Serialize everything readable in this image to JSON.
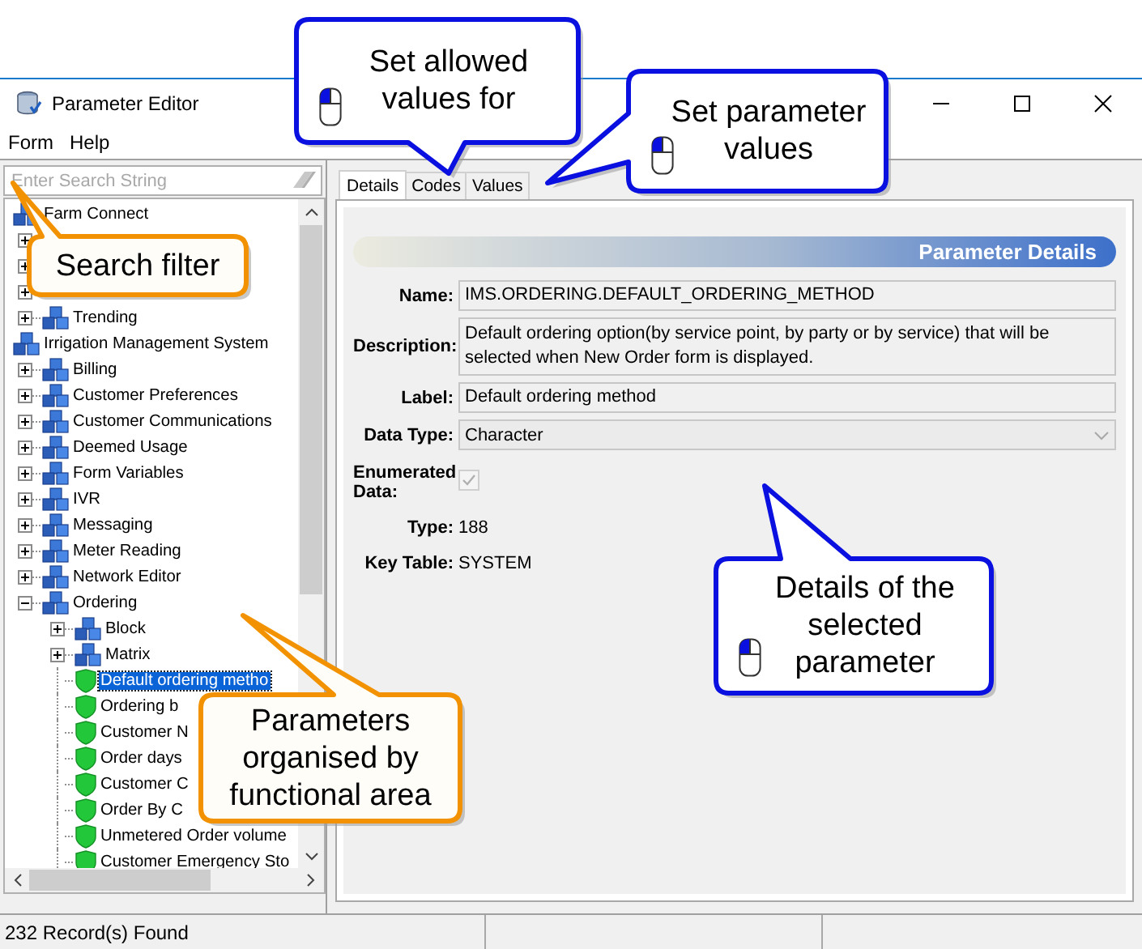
{
  "window": {
    "title": "Parameter Editor"
  },
  "menu": [
    "Form",
    "Help"
  ],
  "search": {
    "placeholder": "Enter Search String"
  },
  "tree": [
    {
      "kind": "group",
      "label": "Farm Connect",
      "children": [
        {
          "kind": "group",
          "expanded": false
        },
        {
          "kind": "group",
          "expanded": false
        },
        {
          "kind": "group",
          "expanded": false
        },
        {
          "kind": "group",
          "label": "Trending",
          "expanded": false
        }
      ]
    },
    {
      "kind": "group",
      "label": "Irrigation Management System",
      "children": [
        {
          "kind": "group",
          "label": "Billing",
          "expanded": false
        },
        {
          "kind": "group",
          "label": "Customer Preferences",
          "expanded": false
        },
        {
          "kind": "group",
          "label": "Customer Communications",
          "expanded": false
        },
        {
          "kind": "group",
          "label": "Deemed Usage",
          "expanded": false
        },
        {
          "kind": "group",
          "label": "Form Variables",
          "expanded": false
        },
        {
          "kind": "group",
          "label": "IVR",
          "expanded": false
        },
        {
          "kind": "group",
          "label": "Messaging",
          "expanded": false
        },
        {
          "kind": "group",
          "label": "Meter Reading",
          "expanded": false
        },
        {
          "kind": "group",
          "label": "Network Editor",
          "expanded": false
        },
        {
          "kind": "group",
          "label": "Ordering",
          "expanded": true,
          "children": [
            {
              "kind": "group",
              "label": "Block",
              "expanded": false
            },
            {
              "kind": "group",
              "label": "Matrix",
              "expanded": false
            },
            {
              "kind": "parameter",
              "label": "Default ordering metho",
              "selected": true
            },
            {
              "kind": "parameter",
              "label": "Ordering b",
              "selected": false
            },
            {
              "kind": "parameter",
              "label": "Customer N",
              "selected": false
            },
            {
              "kind": "parameter",
              "label": "Order days",
              "selected": false
            },
            {
              "kind": "parameter",
              "label": "Customer C",
              "selected": false
            },
            {
              "kind": "parameter",
              "label": "Order By C",
              "selected": false
            },
            {
              "kind": "parameter",
              "label": "Unmetered Order volume",
              "selected": false
            },
            {
              "kind": "parameter",
              "label": "Customer Emergency Sto",
              "selected": false
            }
          ]
        }
      ]
    }
  ],
  "tabs": [
    {
      "label": "Details",
      "selected": true
    },
    {
      "label": "Codes",
      "selected": false
    },
    {
      "label": "Values",
      "selected": false
    }
  ],
  "details": {
    "header": "Parameter Details",
    "fields": [
      {
        "kind": "text",
        "label": "Name:",
        "value": "IMS.ORDERING.DEFAULT_ORDERING_METHOD"
      },
      {
        "kind": "textarea",
        "label": "Description:",
        "value": "Default ordering option(by service point, by party or by service) that will be selected when New Order form is displayed."
      },
      {
        "kind": "text",
        "label": "Label:",
        "value": "Default ordering method"
      },
      {
        "kind": "combo",
        "label": "Data Type:",
        "value": "Character"
      },
      {
        "kind": "checkbox",
        "label": "Enumerated Data:",
        "checked": true
      },
      {
        "kind": "plain",
        "label": "Type:",
        "value": "188"
      },
      {
        "kind": "plain",
        "label": "Key Table:",
        "value": "SYSTEM"
      }
    ]
  },
  "status_bar": {
    "text": "232 Record(s) Found"
  },
  "callouts": [
    {
      "kind": "blue",
      "lines": [
        "Set allowed",
        "values for"
      ],
      "mouse": true
    },
    {
      "kind": "blue",
      "lines": [
        "Set parameter",
        "values"
      ],
      "mouse": true
    },
    {
      "kind": "orange",
      "lines": [
        "Search filter"
      ],
      "mouse": false
    },
    {
      "kind": "orange",
      "lines": [
        "Parameters",
        "organised by",
        "functional area"
      ],
      "mouse": false
    },
    {
      "kind": "blue",
      "lines": [
        "Details of the",
        "selected",
        "parameter"
      ],
      "mouse": true
    }
  ]
}
